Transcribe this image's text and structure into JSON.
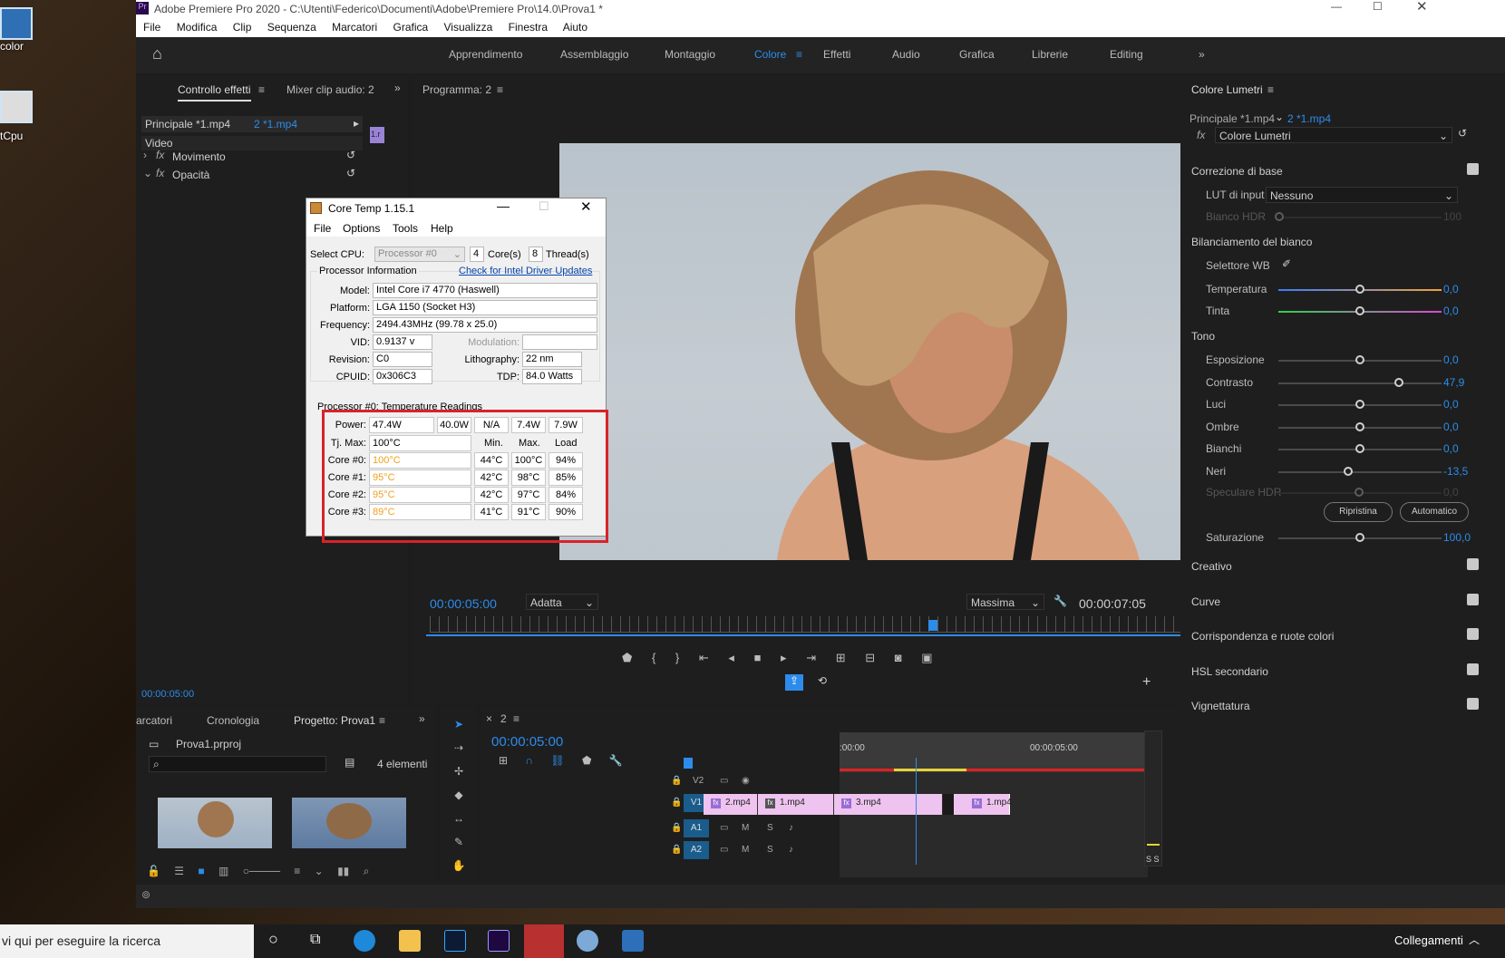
{
  "desktop": {
    "icons": [
      {
        "label": "color"
      },
      {
        "label": "tCpu"
      }
    ]
  },
  "premiere": {
    "title": "Adobe Premiere Pro 2020 - C:\\Utenti\\Federico\\Documenti\\Adobe\\Premiere Pro\\14.0\\Prova1 *",
    "menu": [
      "File",
      "Modifica",
      "Clip",
      "Sequenza",
      "Marcatori",
      "Grafica",
      "Visualizza",
      "Finestra",
      "Aiuto"
    ],
    "workspaces": [
      "Apprendimento",
      "Assemblaggio",
      "Montaggio",
      "Colore",
      "Effetti",
      "Audio",
      "Grafica",
      "Librerie",
      "Editing"
    ],
    "active_workspace": "Colore",
    "effect_controls": {
      "tab1": "Controllo effetti",
      "tab2": "Mixer clip audio: 2",
      "source": "Principale *1.mp4",
      "target": "2 *1.mp4",
      "clip_label": "1.r",
      "section": "Video",
      "effects": [
        "Movimento",
        "Opacità"
      ],
      "timecode": "00:00:05:00"
    },
    "program": {
      "title": "Programma: 2",
      "timecode": "00:00:05:00",
      "fit": "Adatta",
      "quality": "Massima",
      "duration": "00:00:07:05"
    },
    "project": {
      "tabs": [
        "arcatori",
        "Cronologia",
        "Progetto: Prova1"
      ],
      "file": "Prova1.prproj",
      "count": "4 elementi"
    },
    "timeline": {
      "seq": "2",
      "timecode": "00:00:05:00",
      "ruler": [
        ":00:00",
        "00:00:05:00"
      ],
      "tracks": [
        "V2",
        "V1",
        "A1",
        "A2"
      ],
      "clips": [
        "2.mp4",
        "1.mp4",
        "3.mp4",
        "1.mp4"
      ]
    },
    "lumetri": {
      "title": "Colore Lumetri",
      "source": "Principale *1.mp4",
      "target": "2 *1.mp4",
      "effect": "Colore Lumetri",
      "basic": "Correzione di base",
      "lut_label": "LUT di input",
      "lut_value": "Nessuno",
      "hdr_white": "Bianco HDR",
      "hdr_white_val": "100",
      "wb": "Bilanciamento del bianco",
      "wb_selector": "Selettore WB",
      "temperature": {
        "name": "Temperatura",
        "value": "0,0",
        "pos": 0.5
      },
      "tint": {
        "name": "Tinta",
        "value": "0,0",
        "pos": 0.5
      },
      "tone": "Tono",
      "sliders": [
        {
          "name": "Esposizione",
          "value": "0,0",
          "pos": 0.5
        },
        {
          "name": "Contrasto",
          "value": "47,9",
          "pos": 0.74
        },
        {
          "name": "Luci",
          "value": "0,0",
          "pos": 0.5
        },
        {
          "name": "Ombre",
          "value": "0,0",
          "pos": 0.5
        },
        {
          "name": "Bianchi",
          "value": "0,0",
          "pos": 0.5
        },
        {
          "name": "Neri",
          "value": "-13,5",
          "pos": 0.43
        }
      ],
      "hdr_specular": "Speculare HDR",
      "hdr_specular_val": "0,0",
      "reset": "Ripristina",
      "auto": "Automatico",
      "saturation": {
        "name": "Saturazione",
        "value": "100,0",
        "pos": 0.5
      },
      "sections": [
        "Creativo",
        "Curve",
        "Corrispondenza e ruote colori",
        "HSL secondario",
        "Vignettatura"
      ]
    }
  },
  "coretemp": {
    "title": "Core Temp 1.15.1",
    "menu": [
      "File",
      "Options",
      "Tools",
      "Help"
    ],
    "select_cpu": "Select CPU:",
    "processor": "Processor #0",
    "cores": "4",
    "cores_label": "Core(s)",
    "threads": "8",
    "threads_label": "Thread(s)",
    "info_title": "Processor Information",
    "driver_link": "Check for Intel Driver Updates",
    "model_label": "Model:",
    "model": "Intel Core i7 4770 (Haswell)",
    "platform_label": "Platform:",
    "platform": "LGA 1150 (Socket H3)",
    "freq_label": "Frequency:",
    "freq": "2494.43MHz (99.78 x 25.0)",
    "vid_label": "VID:",
    "vid": "0.9137 v",
    "mod_label": "Modulation:",
    "rev_label": "Revision:",
    "rev": "C0",
    "litho_label": "Lithography:",
    "litho": "22 nm",
    "cpuid_label": "CPUID:",
    "cpuid": "0x306C3",
    "tdp_label": "TDP:",
    "tdp": "84.0 Watts",
    "readings_title": "Processor #0: Temperature Readings",
    "power_label": "Power:",
    "power": [
      "47.4W",
      "40.0W",
      "N/A",
      "7.4W",
      "7.9W"
    ],
    "tj_label": "Tj. Max:",
    "tj": "100°C",
    "cols": [
      "Min.",
      "Max.",
      "Load"
    ],
    "cores_rows": [
      {
        "label": "Core #0:",
        "temp": "100°C",
        "min": "44°C",
        "max": "100°C",
        "load": "94%"
      },
      {
        "label": "Core #1:",
        "temp": "95°C",
        "min": "42°C",
        "max": "98°C",
        "load": "85%"
      },
      {
        "label": "Core #2:",
        "temp": "95°C",
        "min": "42°C",
        "max": "97°C",
        "load": "84%"
      },
      {
        "label": "Core #3:",
        "temp": "89°C",
        "min": "41°C",
        "max": "91°C",
        "load": "90%"
      }
    ],
    "highlight_color": "#d8232a"
  },
  "taskbar": {
    "search": "vi qui per eseguire la ricerca",
    "tray": "Collegamenti"
  }
}
